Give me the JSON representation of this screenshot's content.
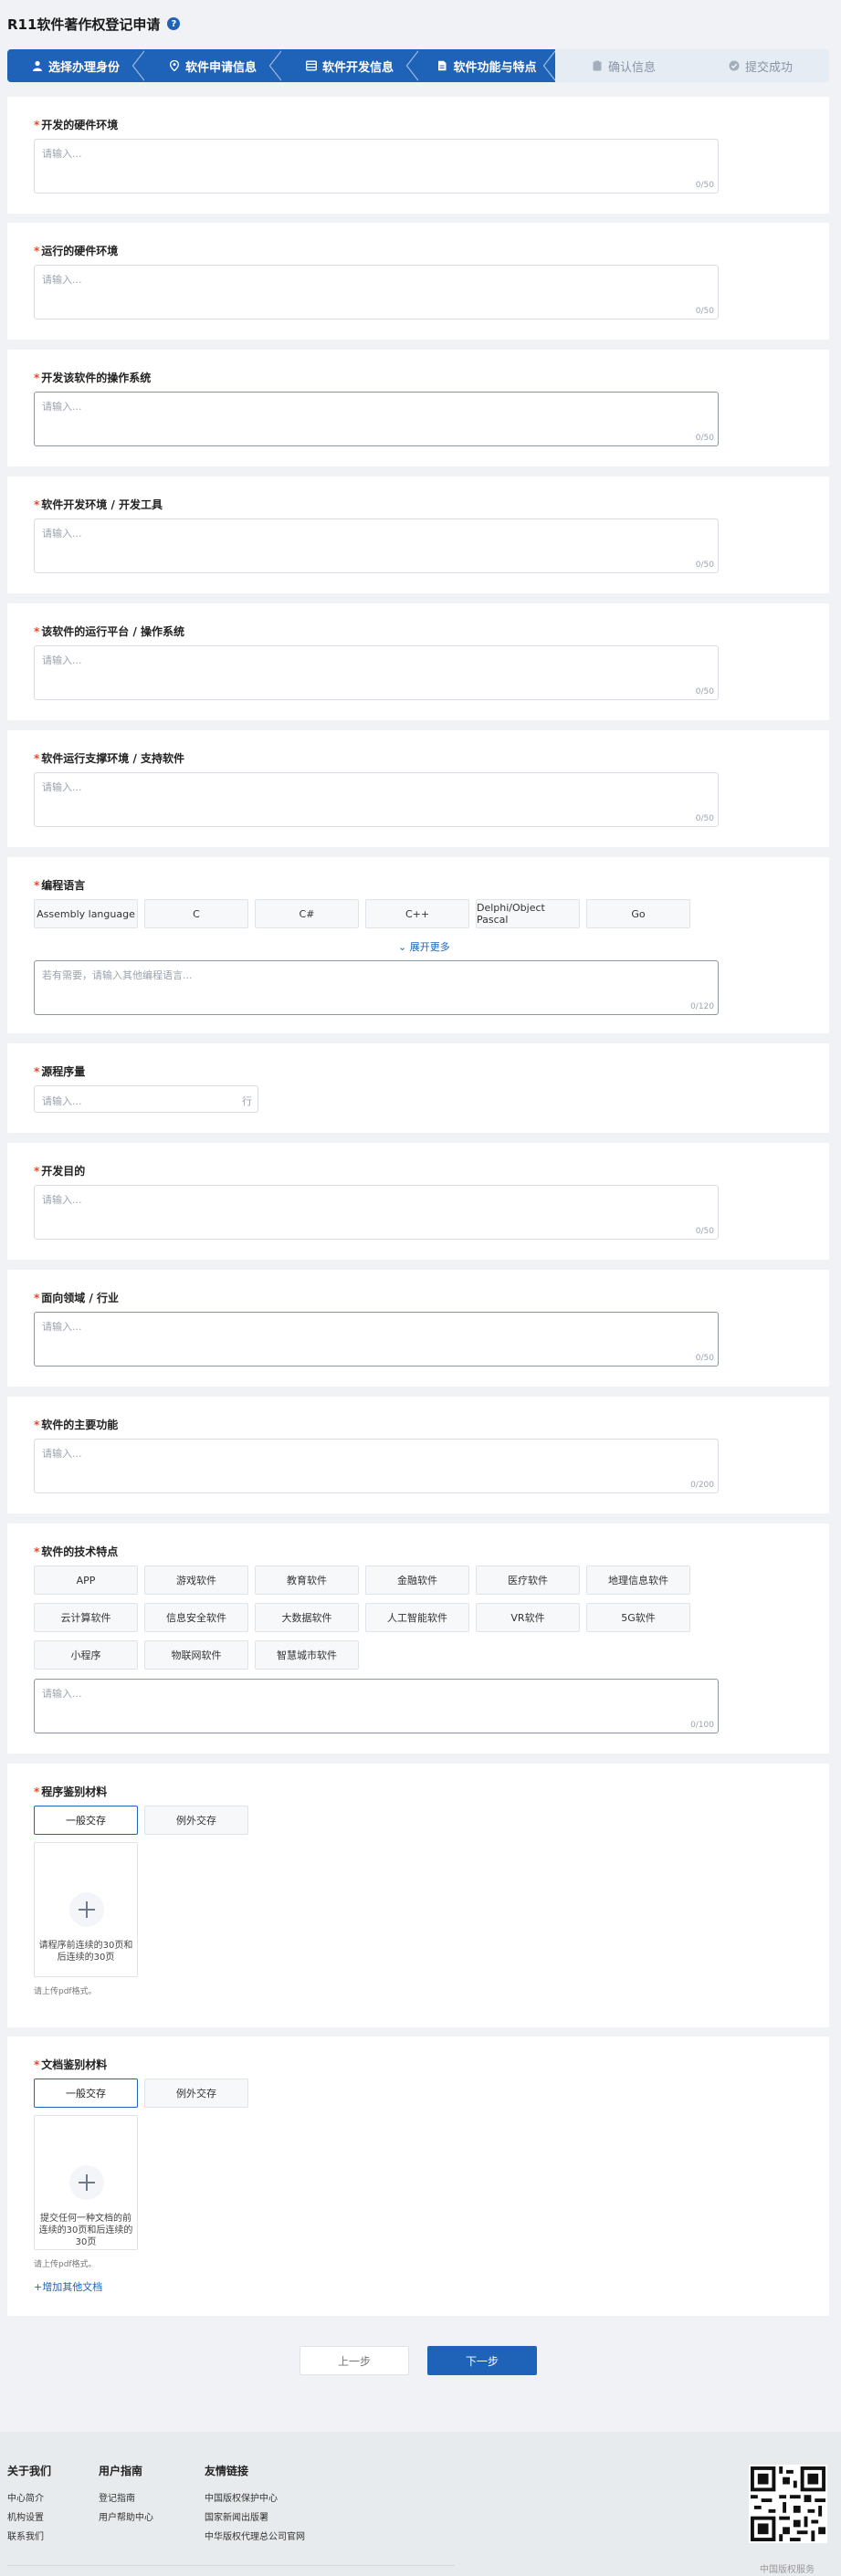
{
  "header": {
    "title": "R11软件著作权登记申请",
    "help": "?"
  },
  "steps": [
    {
      "label": "选择办理身份",
      "state": "active",
      "icon": "user-icon"
    },
    {
      "label": "软件申请信息",
      "state": "active",
      "icon": "location-pin-icon"
    },
    {
      "label": "软件开发信息",
      "state": "active",
      "icon": "table-icon"
    },
    {
      "label": "软件功能与特点",
      "state": "active",
      "icon": "document-icon"
    },
    {
      "label": "确认信息",
      "state": "inactive",
      "icon": "clipboard-icon"
    },
    {
      "label": "提交成功",
      "state": "inactive",
      "icon": "check-circle-icon"
    }
  ],
  "placeholder": "请输入...",
  "fields": {
    "dev_hardware": {
      "label": "开发的硬件环境",
      "count": "0/50"
    },
    "run_hardware": {
      "label": "运行的硬件环境",
      "count": "0/50"
    },
    "dev_os": {
      "label": "开发该软件的操作系统",
      "count": "0/50"
    },
    "dev_tools": {
      "label": "软件开发环境 / 开发工具",
      "count": "0/50"
    },
    "run_platform": {
      "label": "该软件的运行平台 / 操作系统",
      "count": "0/50"
    },
    "support_software": {
      "label": "软件运行支撑环境 / 支持软件",
      "count": "0/50"
    },
    "languages": {
      "label": "编程语言",
      "options": [
        "Assembly language",
        "C",
        "C#",
        "C++",
        "Delphi/Object Pascal",
        "Go"
      ],
      "expand": "展开更多",
      "placeholder": "若有需要，请输入其他编程语言...",
      "count": "0/120"
    },
    "source_lines": {
      "label": "源程序量",
      "placeholder": "请输入...",
      "unit": "行"
    },
    "purpose": {
      "label": "开发目的",
      "count": "0/50"
    },
    "domain": {
      "label": "面向领域 / 行业",
      "count": "0/50"
    },
    "main_functions": {
      "label": "软件的主要功能",
      "count": "0/200"
    },
    "tech_features": {
      "label": "软件的技术特点",
      "options": [
        "APP",
        "游戏软件",
        "教育软件",
        "金融软件",
        "医疗软件",
        "地理信息软件",
        "云计算软件",
        "信息安全软件",
        "大数据软件",
        "人工智能软件",
        "VR软件",
        "5G软件",
        "小程序",
        "物联网软件",
        "智慧城市软件"
      ],
      "count": "0/100"
    },
    "program_material": {
      "label": "程序鉴别材料",
      "options": [
        "一般交存",
        "例外交存"
      ],
      "upload_text": "请程序前连续的30页和后连续的30页",
      "note": "请上传pdf格式。"
    },
    "doc_material": {
      "label": "文档鉴别材料",
      "options": [
        "一般交存",
        "例外交存"
      ],
      "upload_text": "提交任何一种文档的前连续的30页和后连续的30页",
      "note": "请上传pdf格式。",
      "add_link": "+增加其他文档"
    }
  },
  "buttons": {
    "prev": "上一步",
    "next": "下一步"
  },
  "footer": {
    "cols": [
      {
        "title": "关于我们",
        "links": [
          "中心简介",
          "机构设置",
          "联系我们"
        ]
      },
      {
        "title": "用户指南",
        "links": [
          "登记指南",
          "用户帮助中心"
        ]
      },
      {
        "title": "友情链接",
        "links": [
          "中国版权保护中心",
          "国家新闻出版署",
          "中华版权代理总公司官网"
        ]
      }
    ],
    "qr_caption": "中国版权服务"
  }
}
